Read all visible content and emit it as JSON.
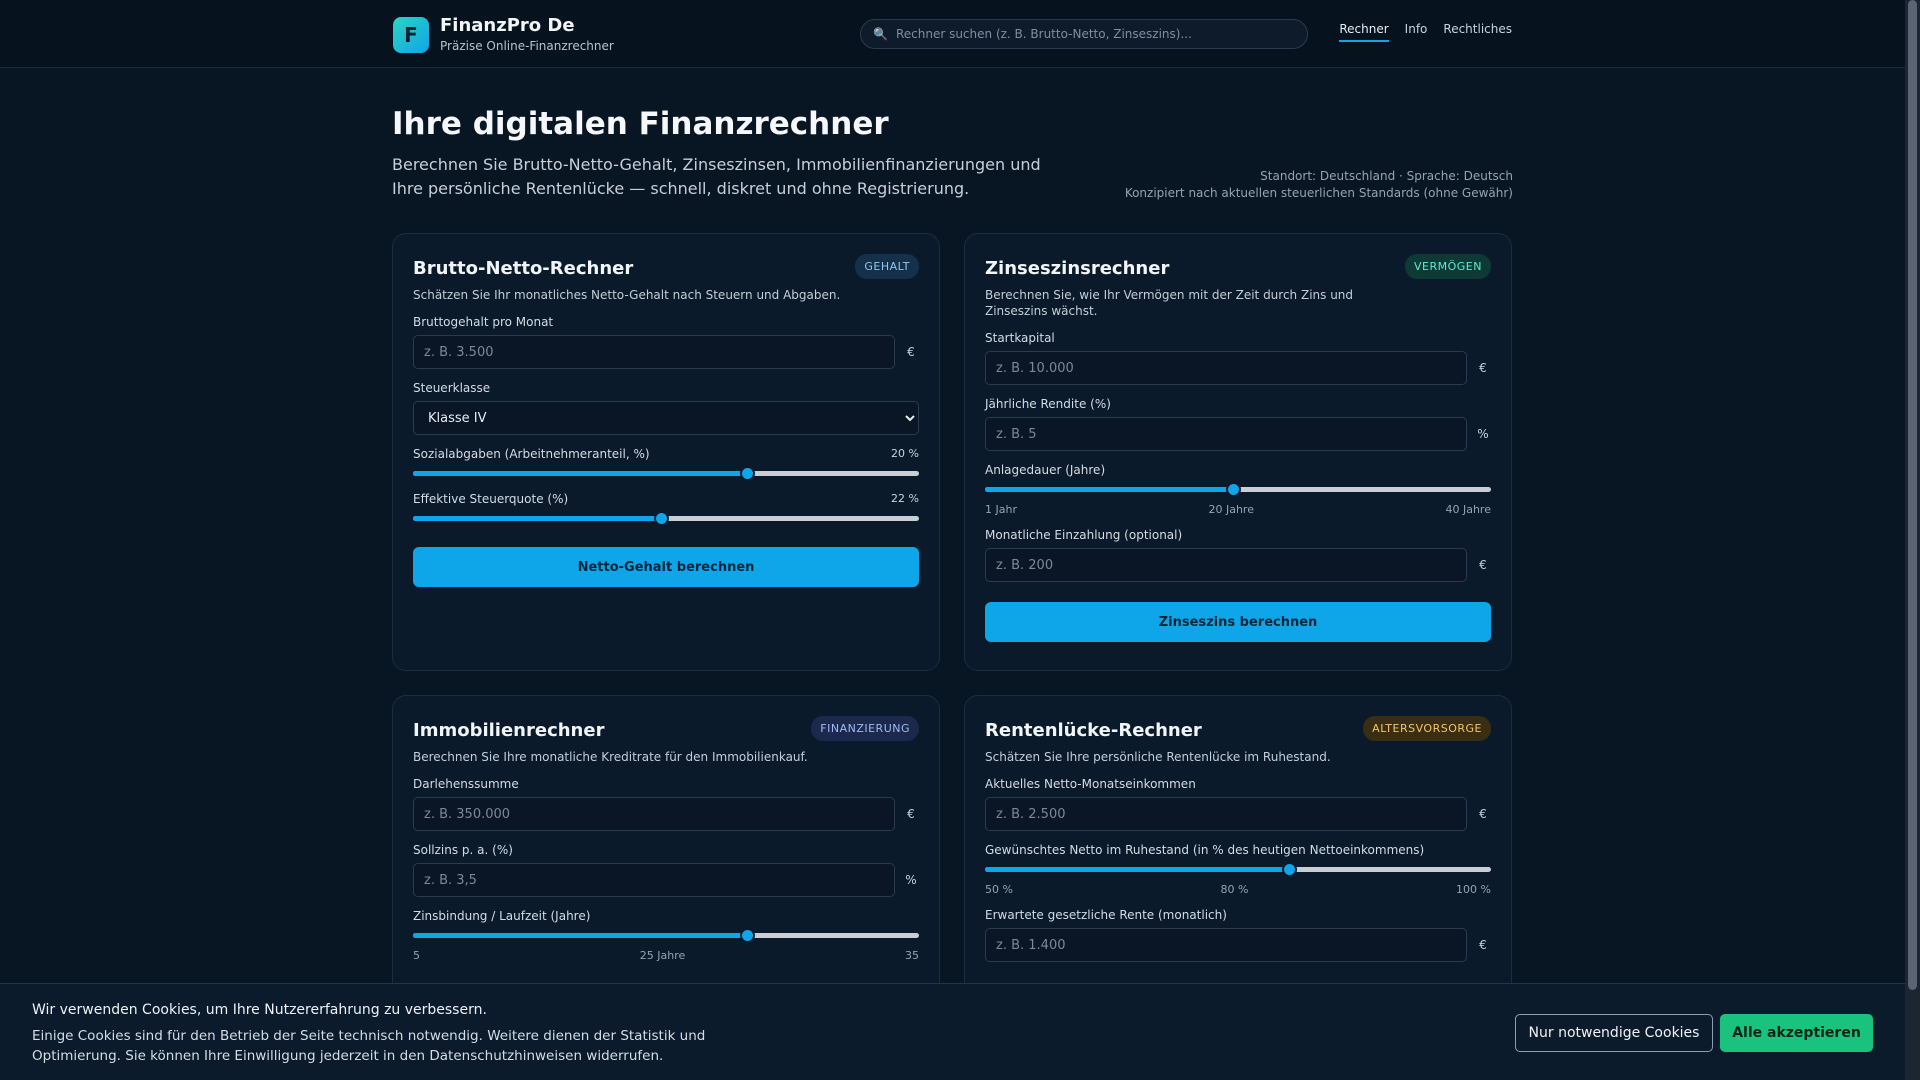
{
  "header": {
    "logo_letter": "F",
    "brand_name": "FinanzPro De",
    "brand_sub": "Präzise Online-Finanzrechner",
    "search_placeholder": "Rechner suchen (z. B. Brutto-Netto, Zinseszins)...",
    "search_icon": "magnifier-icon",
    "nav": [
      "Rechner",
      "Info",
      "Rechtliches"
    ]
  },
  "hero": {
    "title": "Ihre digitalen Finanzrechner",
    "description": "Berechnen Sie Brutto-Netto-Gehalt, Zinseszinsen, Immobilienfinanzierungen und Ihre persönliche Rentenlücke — schnell, diskret und ohne Registrierung.",
    "meta_line1": "Standort: Deutschland · Sprache: Deutsch",
    "meta_line2": "Konzipiert nach aktuellen steuerlichen Standards (ohne Gewähr)"
  },
  "brutto": {
    "title": "Brutto-Netto-Rechner",
    "badge": "GEHALT",
    "desc": "Schätzen Sie Ihr monatliches Netto-Gehalt nach Steuern und Abgaben.",
    "gross_label": "Bruttogehalt pro Monat",
    "gross_placeholder": "z. B. 3.500",
    "gross_unit": "€",
    "class_label": "Steuerklasse",
    "class_value": "Klasse IV",
    "social_label": "Sozialabgaben (Arbeitnehmeranteil, %)",
    "social_value": "20 %",
    "social_level": 0.66,
    "tax_label": "Effektive Steuerquote (%)",
    "tax_value": "22 %",
    "tax_level": 0.49,
    "button": "Netto-Gehalt berechnen"
  },
  "zins": {
    "title": "Zinseszinsrechner",
    "badge": "VERMÖGEN",
    "desc": "Berechnen Sie, wie Ihr Vermögen mit der Zeit durch Zins und Zinseszins wächst.",
    "start_label": "Startkapital",
    "start_placeholder": "z. B. 10.000",
    "start_unit": "€",
    "rate_label": "Jährliche Rendite (%)",
    "rate_placeholder": "z. B. 5",
    "rate_unit": "%",
    "duration_label": "Anlagedauer (Jahre)",
    "duration_level": 0.49,
    "tick_min": "1 Jahr",
    "tick_mid": "20 Jahre",
    "tick_max": "40 Jahre",
    "monthly_label": "Monatliche Einzahlung (optional)",
    "monthly_placeholder": "z. B. 200",
    "monthly_unit": "€",
    "button": "Zinseszins berechnen"
  },
  "immo": {
    "title": "Immobilienrechner",
    "badge": "FINANZIERUNG",
    "desc": "Berechnen Sie Ihre monatliche Kreditrate für den Immobilienkauf.",
    "loan_label": "Darlehenssumme",
    "loan_placeholder": "z. B. 350.000",
    "loan_unit": "€",
    "interest_label": "Sollzins p. a. (%)",
    "interest_placeholder": "z. B. 3,5",
    "interest_unit": "%",
    "term_label": "Zinsbindung / Laufzeit (Jahre)",
    "term_level": 0.66,
    "tick_min": "5",
    "tick_mid": "25 Jahre",
    "tick_max": "35"
  },
  "rente": {
    "title": "Rentenlücke-Rechner",
    "badge": "ALTERSVORSORGE",
    "desc": "Schätzen Sie Ihre persönliche Rentenlücke im Ruhestand.",
    "income_label": "Aktuelles Netto-Monatseinkommen",
    "income_placeholder": "z. B. 2.500",
    "income_unit": "€",
    "target_label": "Gewünschtes Netto im Ruhestand (in % des heutigen Nettoeinkommens)",
    "target_level": 0.6,
    "tick_min": "50 %",
    "tick_mid": "80 %",
    "tick_max": "100 %",
    "pension_label": "Erwartete gesetzliche Rente (monatlich)",
    "pension_placeholder": "z. B. 1.400",
    "pension_unit": "€"
  },
  "cookie": {
    "title": "Wir verwenden Cookies, um Ihre Nutzererfahrung zu verbessern.",
    "text": "Einige Cookies sind für den Betrieb der Seite technisch notwendig. Weitere dienen der Statistik und Optimierung. Sie können Ihre Einwilligung jederzeit in den Datenschutzhinweisen widerrufen.",
    "necessary": "Nur notwendige Cookies",
    "accept": "Alle akzeptieren"
  }
}
